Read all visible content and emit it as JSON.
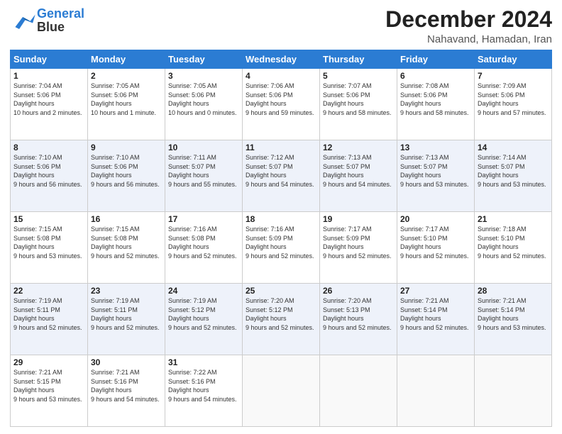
{
  "header": {
    "logo_line1": "General",
    "logo_line2": "Blue",
    "month": "December 2024",
    "location": "Nahavand, Hamadan, Iran"
  },
  "days_of_week": [
    "Sunday",
    "Monday",
    "Tuesday",
    "Wednesday",
    "Thursday",
    "Friday",
    "Saturday"
  ],
  "weeks": [
    [
      {
        "day": 1,
        "sunrise": "7:04 AM",
        "sunset": "5:06 PM",
        "daylight": "10 hours and 2 minutes."
      },
      {
        "day": 2,
        "sunrise": "7:05 AM",
        "sunset": "5:06 PM",
        "daylight": "10 hours and 1 minute."
      },
      {
        "day": 3,
        "sunrise": "7:05 AM",
        "sunset": "5:06 PM",
        "daylight": "10 hours and 0 minutes."
      },
      {
        "day": 4,
        "sunrise": "7:06 AM",
        "sunset": "5:06 PM",
        "daylight": "9 hours and 59 minutes."
      },
      {
        "day": 5,
        "sunrise": "7:07 AM",
        "sunset": "5:06 PM",
        "daylight": "9 hours and 58 minutes."
      },
      {
        "day": 6,
        "sunrise": "7:08 AM",
        "sunset": "5:06 PM",
        "daylight": "9 hours and 58 minutes."
      },
      {
        "day": 7,
        "sunrise": "7:09 AM",
        "sunset": "5:06 PM",
        "daylight": "9 hours and 57 minutes."
      }
    ],
    [
      {
        "day": 8,
        "sunrise": "7:10 AM",
        "sunset": "5:06 PM",
        "daylight": "9 hours and 56 minutes."
      },
      {
        "day": 9,
        "sunrise": "7:10 AM",
        "sunset": "5:06 PM",
        "daylight": "9 hours and 56 minutes."
      },
      {
        "day": 10,
        "sunrise": "7:11 AM",
        "sunset": "5:07 PM",
        "daylight": "9 hours and 55 minutes."
      },
      {
        "day": 11,
        "sunrise": "7:12 AM",
        "sunset": "5:07 PM",
        "daylight": "9 hours and 54 minutes."
      },
      {
        "day": 12,
        "sunrise": "7:13 AM",
        "sunset": "5:07 PM",
        "daylight": "9 hours and 54 minutes."
      },
      {
        "day": 13,
        "sunrise": "7:13 AM",
        "sunset": "5:07 PM",
        "daylight": "9 hours and 53 minutes."
      },
      {
        "day": 14,
        "sunrise": "7:14 AM",
        "sunset": "5:07 PM",
        "daylight": "9 hours and 53 minutes."
      }
    ],
    [
      {
        "day": 15,
        "sunrise": "7:15 AM",
        "sunset": "5:08 PM",
        "daylight": "9 hours and 53 minutes."
      },
      {
        "day": 16,
        "sunrise": "7:15 AM",
        "sunset": "5:08 PM",
        "daylight": "9 hours and 52 minutes."
      },
      {
        "day": 17,
        "sunrise": "7:16 AM",
        "sunset": "5:08 PM",
        "daylight": "9 hours and 52 minutes."
      },
      {
        "day": 18,
        "sunrise": "7:16 AM",
        "sunset": "5:09 PM",
        "daylight": "9 hours and 52 minutes."
      },
      {
        "day": 19,
        "sunrise": "7:17 AM",
        "sunset": "5:09 PM",
        "daylight": "9 hours and 52 minutes."
      },
      {
        "day": 20,
        "sunrise": "7:17 AM",
        "sunset": "5:10 PM",
        "daylight": "9 hours and 52 minutes."
      },
      {
        "day": 21,
        "sunrise": "7:18 AM",
        "sunset": "5:10 PM",
        "daylight": "9 hours and 52 minutes."
      }
    ],
    [
      {
        "day": 22,
        "sunrise": "7:19 AM",
        "sunset": "5:11 PM",
        "daylight": "9 hours and 52 minutes."
      },
      {
        "day": 23,
        "sunrise": "7:19 AM",
        "sunset": "5:11 PM",
        "daylight": "9 hours and 52 minutes."
      },
      {
        "day": 24,
        "sunrise": "7:19 AM",
        "sunset": "5:12 PM",
        "daylight": "9 hours and 52 minutes."
      },
      {
        "day": 25,
        "sunrise": "7:20 AM",
        "sunset": "5:12 PM",
        "daylight": "9 hours and 52 minutes."
      },
      {
        "day": 26,
        "sunrise": "7:20 AM",
        "sunset": "5:13 PM",
        "daylight": "9 hours and 52 minutes."
      },
      {
        "day": 27,
        "sunrise": "7:21 AM",
        "sunset": "5:14 PM",
        "daylight": "9 hours and 52 minutes."
      },
      {
        "day": 28,
        "sunrise": "7:21 AM",
        "sunset": "5:14 PM",
        "daylight": "9 hours and 53 minutes."
      }
    ],
    [
      {
        "day": 29,
        "sunrise": "7:21 AM",
        "sunset": "5:15 PM",
        "daylight": "9 hours and 53 minutes."
      },
      {
        "day": 30,
        "sunrise": "7:21 AM",
        "sunset": "5:16 PM",
        "daylight": "9 hours and 54 minutes."
      },
      {
        "day": 31,
        "sunrise": "7:22 AM",
        "sunset": "5:16 PM",
        "daylight": "9 hours and 54 minutes."
      },
      null,
      null,
      null,
      null
    ]
  ],
  "labels": {
    "sunrise": "Sunrise:",
    "sunset": "Sunset:",
    "daylight": "Daylight:"
  }
}
